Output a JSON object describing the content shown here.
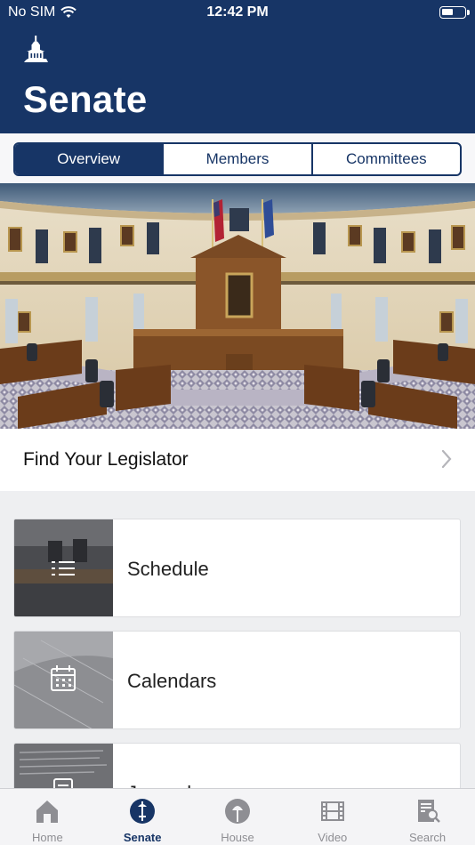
{
  "status_bar": {
    "carrier": "No SIM",
    "time": "12:42 PM"
  },
  "header": {
    "title": "Senate"
  },
  "segments": [
    {
      "label": "Overview",
      "active": true
    },
    {
      "label": "Members",
      "active": false
    },
    {
      "label": "Committees",
      "active": false
    }
  ],
  "find_legislator": {
    "label": "Find Your Legislator"
  },
  "cards": [
    {
      "title": "Schedule",
      "icon": "list-icon"
    },
    {
      "title": "Calendars",
      "icon": "calendar-icon"
    },
    {
      "title": "Journals",
      "icon": "document-icon"
    }
  ],
  "tabbar": [
    {
      "label": "Home",
      "icon": "home-icon",
      "active": false
    },
    {
      "label": "Senate",
      "icon": "senate-icon",
      "active": true
    },
    {
      "label": "House",
      "icon": "house-icon",
      "active": false
    },
    {
      "label": "Video",
      "icon": "film-icon",
      "active": false
    },
    {
      "label": "Search",
      "icon": "search-icon",
      "active": false
    }
  ],
  "colors": {
    "brand_navy": "#173566",
    "inactive_gray": "#8e8e93"
  }
}
